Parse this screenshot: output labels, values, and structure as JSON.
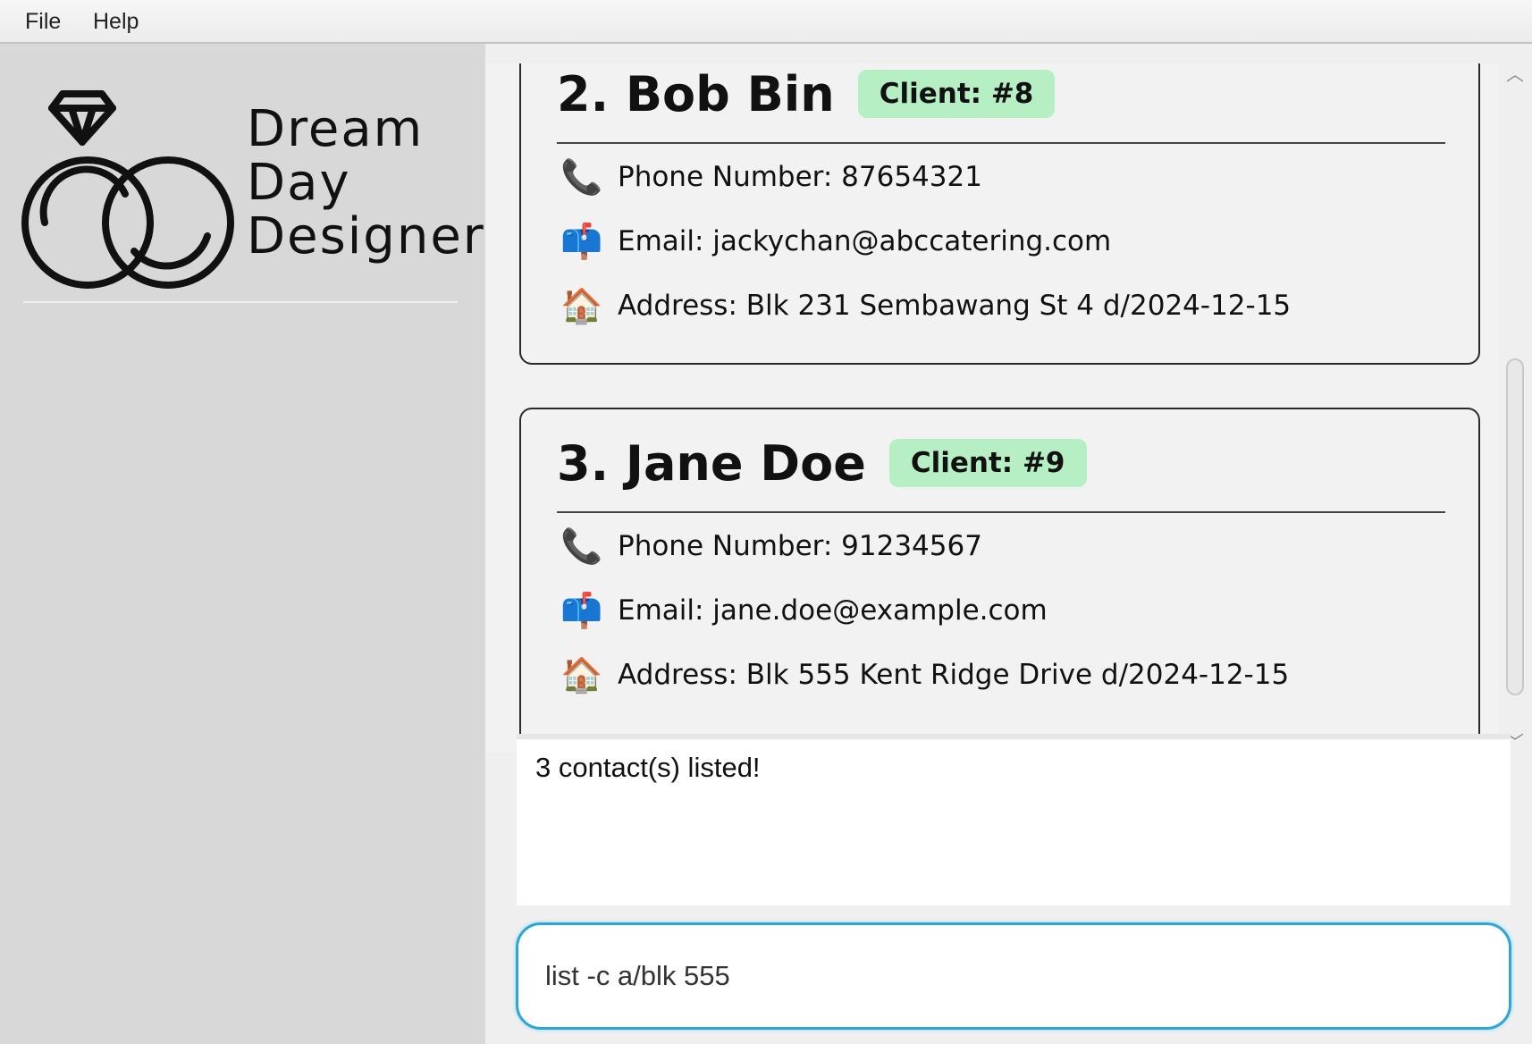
{
  "menu": {
    "file": "File",
    "help": "Help"
  },
  "logo": {
    "line1": "Dream",
    "line2": "Day",
    "line3": "Designer"
  },
  "contacts": [
    {
      "name": "2. Bob Bin",
      "badge": "Client: #8",
      "phone": "Phone Number: 87654321",
      "email": "Email: jackychan@abccatering.com",
      "address": "Address: Blk 231 Sembawang St 4 d/2024-12-15"
    },
    {
      "name": "3. Jane Doe",
      "badge": "Client: #9",
      "phone": "Phone Number: 91234567",
      "email": "Email: jane.doe@example.com",
      "address": "Address: Blk 555 Kent Ridge Drive d/2024-12-15"
    }
  ],
  "icons": {
    "phone": "telephone-icon",
    "email": "mailbox-icon",
    "address": "house-icon"
  },
  "result": {
    "message": "3 contact(s) listed!"
  },
  "command": {
    "value": "list -c a/blk 555"
  },
  "colors": {
    "badge": "#b7efc5",
    "focus": "#2ba7d6",
    "sidebar": "#d8d8d8"
  }
}
